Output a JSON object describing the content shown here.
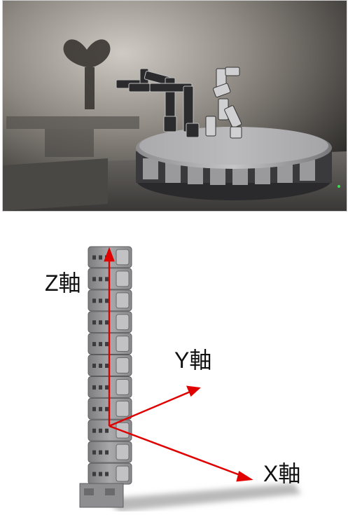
{
  "photo": {
    "description_icon": "robot-arms-on-turntable-photo"
  },
  "diagram": {
    "z_axis_label": "Z軸",
    "y_axis_label": "Y軸",
    "x_axis_label": "X軸",
    "arrow_color": "#e00000",
    "module_color": "#9a9a9a"
  }
}
